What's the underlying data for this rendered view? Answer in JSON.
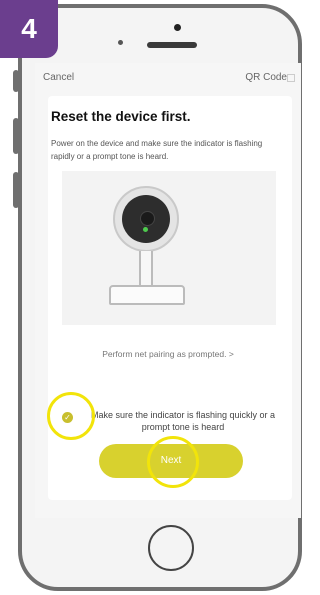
{
  "step_badge": "4",
  "topbar": {
    "cancel_label": "Cancel",
    "qr_label": "QR Code"
  },
  "main": {
    "title": "Reset the device first.",
    "description": "Power on the device and make sure the indicator is flashing rapidly or a prompt tone is heard.",
    "pairing_link": "Perform net pairing as prompted. >",
    "confirm_text": "Make sure the indicator is flashing quickly or a prompt tone is heard",
    "next_label": "Next",
    "checkbox_checked": true
  },
  "colors": {
    "badge": "#6b3e8e",
    "accent": "#d8d12e",
    "highlight": "#f2e40a"
  },
  "icons": [
    "camera-illustration",
    "check-icon",
    "qr-icon"
  ]
}
